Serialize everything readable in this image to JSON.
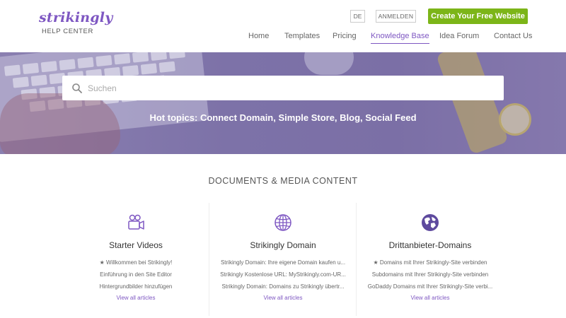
{
  "brand": {
    "name": "strikingly",
    "subtitle": "HELP CENTER",
    "accent_color": "#7e57c2",
    "cta_color": "#7cb518"
  },
  "header": {
    "lang_label": "DE",
    "login_label": "ANMELDEN",
    "cta_label": "Create Your Free Website"
  },
  "nav": {
    "items": [
      {
        "label": "Home"
      },
      {
        "label": "Templates"
      },
      {
        "label": "Pricing"
      },
      {
        "label": "Knowledge Base"
      },
      {
        "label": "Idea Forum"
      },
      {
        "label": "Contact Us"
      }
    ],
    "active": "Knowledge Base"
  },
  "hero": {
    "search_placeholder": "Suchen",
    "hot_topics": "Hot topics: Connect Domain, Simple Store, Blog, Social Feed"
  },
  "section": {
    "title": "DOCUMENTS & MEDIA CONTENT"
  },
  "cards": [
    {
      "icon": "video-camera-icon",
      "title": "Starter Videos",
      "articles": [
        "★ Willkommen bei Strikingly!",
        "Einführung in den Site Editor",
        "Hintergrundbilder hinzufügen"
      ],
      "view_all": "View all articles"
    },
    {
      "icon": "globe-icon",
      "title": "Strikingly Domain",
      "articles": [
        "Strikingly Domain: Ihre eigene Domain kaufen u...",
        "Strikingly Kostenlose URL: MyStrikingly.com-UR...",
        "Strikingly Domain: Domains zu Strikingly übertr..."
      ],
      "view_all": "View all articles"
    },
    {
      "icon": "earth-icon",
      "title": "Drittanbieter-Domains",
      "articles": [
        "★ Domains mit Ihrer Strikingly-Site verbinden",
        "Subdomains mit Ihrer Strikingly-Site verbinden",
        "GoDaddy Domains mit Ihrer Strikingly-Site verbi..."
      ],
      "view_all": "View all articles"
    }
  ]
}
